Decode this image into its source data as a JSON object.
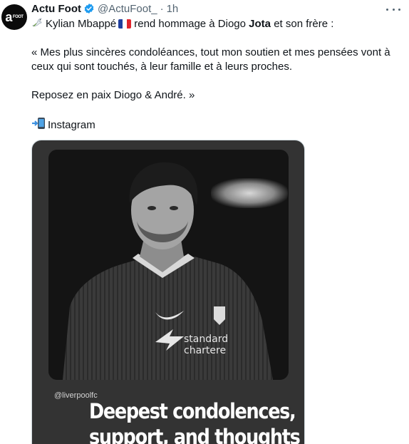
{
  "author": {
    "display_name": "Actu Foot",
    "handle": "@ActuFoot_",
    "time": "1h",
    "dot": "·"
  },
  "tweet": {
    "line1_pre": "Kylian Mbappé",
    "line1_mid": "rend hommage à Diogo",
    "line1_bold": "Jota",
    "line1_post": "et son frère :",
    "quote": "« Mes plus sincères condoléances, tout mon soutien et mes pensées vont à ceux qui sont touchés, à leur famille et à leurs proches.",
    "farewell": "Reposez en paix Diogo & André. »",
    "source": "Instagram"
  },
  "media": {
    "watermark": "@liverpoolfc",
    "caption_line1": "Deepest condolences,",
    "caption_line2": "support, and thoughts are"
  },
  "icons": {
    "verified": "verified-badge-icon",
    "more": "more-options-icon",
    "dove": "dove-emoji",
    "flag": "france-flag-emoji",
    "phone": "mobile-phone-arrow-emoji"
  },
  "colors": {
    "verified": "#1d9bf0",
    "text": "#0f1419",
    "secondary": "#536471"
  }
}
